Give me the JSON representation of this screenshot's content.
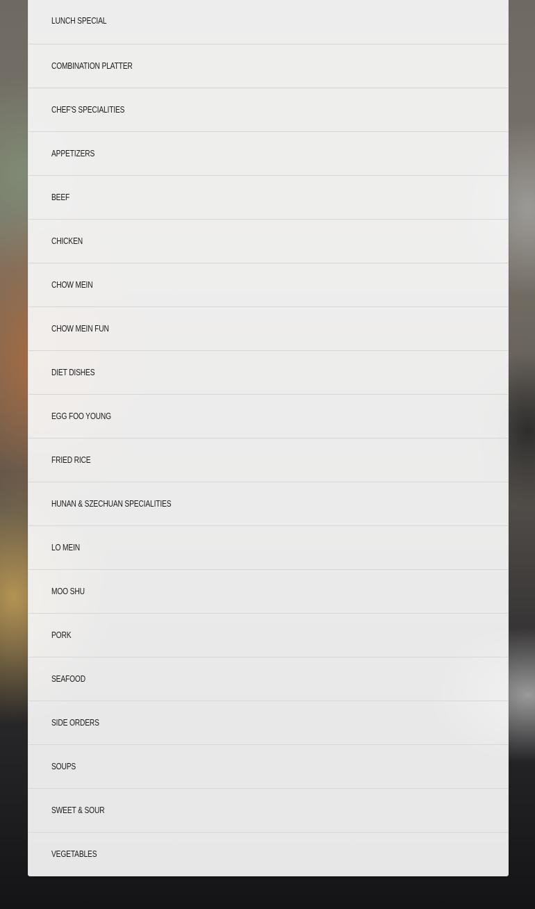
{
  "menu": {
    "categories": [
      {
        "label": "LUNCH SPECIAL"
      },
      {
        "label": "COMBINATION PLATTER"
      },
      {
        "label": "CHEF'S SPECIALITIES"
      },
      {
        "label": "APPETIZERS"
      },
      {
        "label": "BEEF"
      },
      {
        "label": "CHICKEN"
      },
      {
        "label": "CHOW MEIN"
      },
      {
        "label": "CHOW MEIN FUN"
      },
      {
        "label": "DIET DISHES"
      },
      {
        "label": "EGG FOO YOUNG"
      },
      {
        "label": "FRIED RICE"
      },
      {
        "label": "HUNAN & SZECHUAN SPECIALITIES"
      },
      {
        "label": "LO MEIN"
      },
      {
        "label": "MOO SHU"
      },
      {
        "label": "PORK"
      },
      {
        "label": "SEAFOOD"
      },
      {
        "label": "SIDE ORDERS"
      },
      {
        "label": "SOUPS"
      },
      {
        "label": "SWEET & SOUR"
      },
      {
        "label": "VEGETABLES"
      }
    ]
  }
}
